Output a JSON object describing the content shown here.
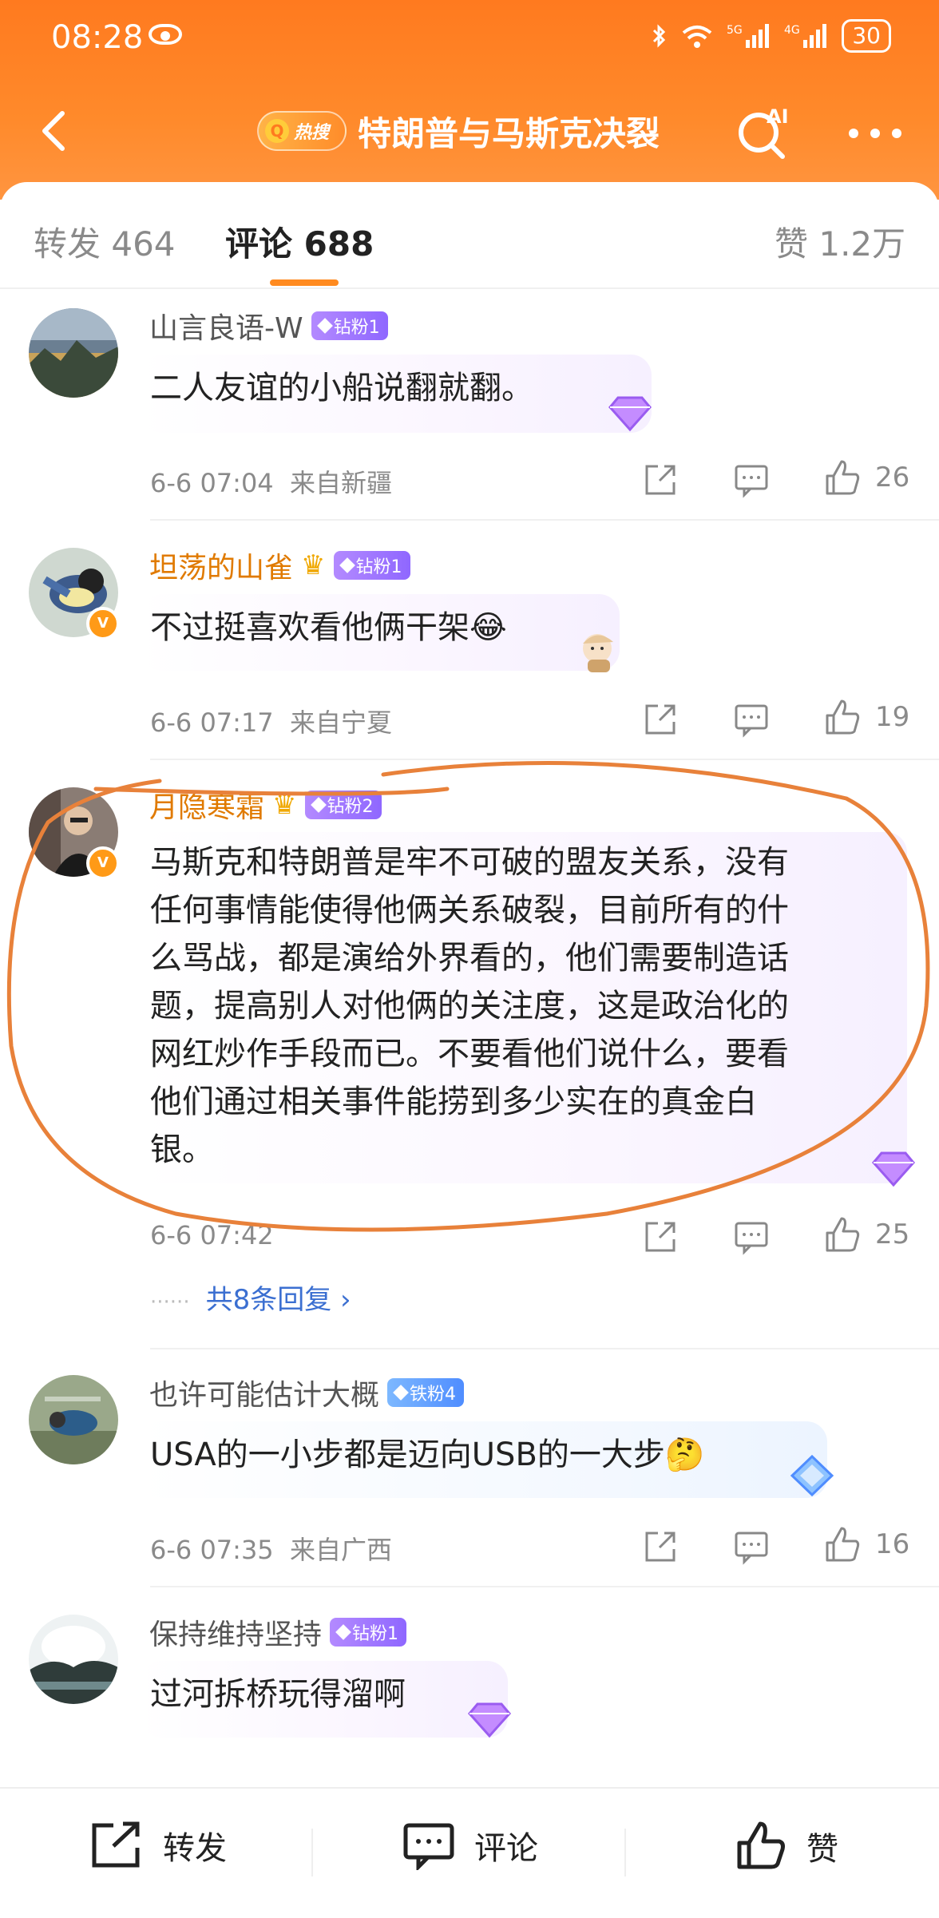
{
  "status_bar": {
    "time": "08:28",
    "network": "5G 4G",
    "battery": "30"
  },
  "nav": {
    "hot_label": "热搜",
    "title": "特朗普与马斯克决裂",
    "ai_label": "AI"
  },
  "tabs": [
    {
      "label": "转发 464"
    },
    {
      "label": "评论 688"
    },
    {
      "label": "赞 1.2万"
    }
  ],
  "comments": [
    {
      "name": "山言良语-W",
      "fan_badge": "钻粉1",
      "text": "二人友谊的小船说翻就翻。",
      "time": "6-6 07:04",
      "location": "来自新疆",
      "likes": "26"
    },
    {
      "name": "坦荡的山雀",
      "fan_badge": "钻粉1",
      "text": "不过挺喜欢看他俩干架😂",
      "time": "6-6 07:17",
      "location": "来自宁夏",
      "likes": "19"
    },
    {
      "name": "月隐寒霜",
      "fan_badge": "钻粉2",
      "text_lines": [
        "马斯克和特朗普是牢不可破的盟友关系，没有",
        "任何事情能使得他俩关系破裂，目前所有的什",
        "么骂战，都是演给外界看的，他们需要制造话",
        "题，提高别人对他俩的关注度，这是政治化的",
        "网红炒作手段而已。不要看他们说什么，要看",
        "他们通过相关事件能捞到多少实在的真金白",
        "银。"
      ],
      "time": "6-6 07:42",
      "likes": "25",
      "replies_label": "共8条回复"
    },
    {
      "name": "也许可能估计大概",
      "fan_badge": "铁粉4",
      "text": "USA的一小步都是迈向USB的一大步🤔",
      "time": "6-6 07:35",
      "location": "来自广西",
      "likes": "16"
    },
    {
      "name": "保持维持坚持",
      "fan_badge": "钻粉1",
      "text": "过河拆桥玩得溜啊"
    }
  ],
  "bottom_bar": {
    "repost": "转发",
    "comment": "评论",
    "like": "赞"
  },
  "colors": {
    "header": "#ff7a1f",
    "accent": "#ff8a1f",
    "link": "#3b6fd1",
    "annotation": "#e8813a"
  }
}
